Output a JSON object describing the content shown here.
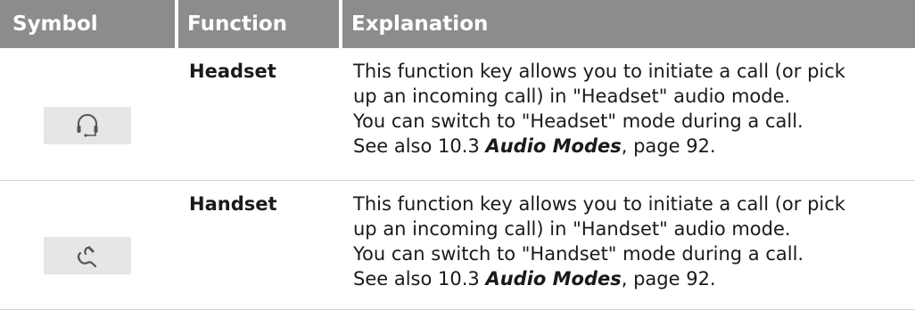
{
  "header": {
    "symbol": "Symbol",
    "function": "Function",
    "explanation": "Explanation"
  },
  "rows": [
    {
      "icon": "headset-icon",
      "function": "Headset",
      "explanation": {
        "line1": "This function key allows you to initiate a call (or pick",
        "line2": "up an incoming call) in \"Headset\" audio mode.",
        "line3": "You can switch to \"Headset\" mode during a call.",
        "line4_prefix": "See also 10.3 ",
        "line4_ref": "Audio Modes",
        "line4_suffix": ", page 92."
      }
    },
    {
      "icon": "handset-icon",
      "function": "Handset",
      "explanation": {
        "line1": "This function key allows you to initiate a call (or pick",
        "line2": "up an incoming call) in \"Handset\" audio mode.",
        "line3": "You can switch to \"Handset\" mode during a call.",
        "line4_prefix": "See also 10.3 ",
        "line4_ref": "Audio Modes",
        "line4_suffix": ", page 92."
      }
    }
  ],
  "colors": {
    "header_bg": "#8c8c8c",
    "header_text": "#ffffff",
    "key_bg": "#e6e6e6",
    "icon_stroke": "#555555"
  }
}
